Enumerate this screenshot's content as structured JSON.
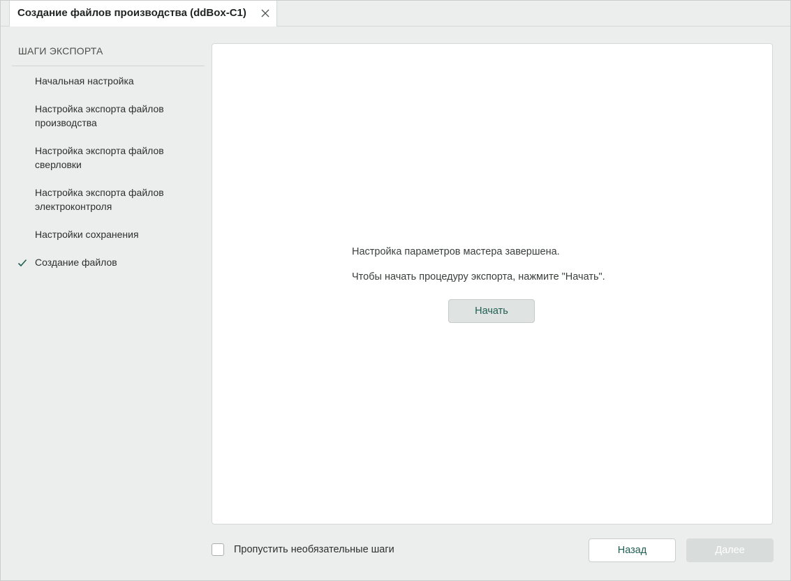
{
  "tab": {
    "title": "Создание файлов производства (ddBox-C1)",
    "close_icon": "close-icon"
  },
  "sidebar": {
    "title": "ШАГИ ЭКСПОРТА",
    "steps": [
      {
        "label": "Начальная настройка",
        "completed": false
      },
      {
        "label": "Настройка экспорта файлов производства",
        "completed": false
      },
      {
        "label": "Настройка экспорта файлов сверловки",
        "completed": false
      },
      {
        "label": "Настройка экспорта файлов электроконтроля",
        "completed": false
      },
      {
        "label": "Настройки сохранения",
        "completed": false
      },
      {
        "label": "Создание файлов",
        "completed": true,
        "icon": "checkmark-icon"
      }
    ]
  },
  "main": {
    "message_line1": "Настройка параметров мастера завершена.",
    "message_line2": "Чтобы начать процедуру экспорта, нажмите \"Начать\".",
    "start_label": "Начать"
  },
  "footer": {
    "skip_label": "Пропустить необязательные шаги",
    "skip_checked": false,
    "back_label": "Назад",
    "next_label": "Далее",
    "next_enabled": false
  },
  "colors": {
    "accent": "#1f5e52",
    "background": "#eceeed",
    "panel": "#ffffff"
  }
}
